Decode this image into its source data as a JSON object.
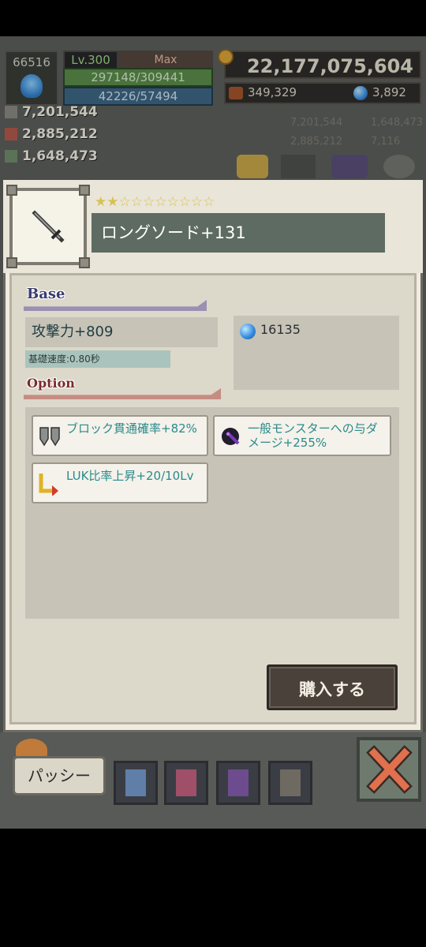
{
  "hud": {
    "player_id": "66516",
    "level": "Lv.300",
    "max_label": "Max",
    "hp": "297148/309441",
    "mp": "42226/57494",
    "gold": "22,177,075,604",
    "resource_a": "349,329",
    "resource_b": "3,892",
    "stat_1": "7,201,544",
    "stat_2": "2,885,212",
    "stat_3": "1,648,473",
    "right_stat_1": "7,201,544",
    "right_stat_2": "1,648,473",
    "right_stat_3": "2,885,212",
    "right_stat_4": "7,116"
  },
  "item": {
    "stars_filled": 2,
    "stars_total": 10,
    "stars_text": "★★☆☆☆☆☆☆☆☆",
    "name": "ロングソード+131",
    "icon": "sword-icon"
  },
  "base": {
    "label": "Base",
    "attack": "攻撃力+809",
    "speed": "基礎速度:0.80秒",
    "price": "16135"
  },
  "option": {
    "label": "Option",
    "items": [
      {
        "text": "ブロック貫通確率+82%",
        "icon": "shield-pierce-icon"
      },
      {
        "text": "一般モンスターへの与ダメージ+255%",
        "icon": "dark-monster-icon"
      },
      {
        "text": "LUK比率上昇+20/10Lv",
        "icon": "luk-arrow-icon"
      }
    ]
  },
  "buttons": {
    "buy": "購入する",
    "passy": "パッシー",
    "close": "close-icon"
  },
  "colors": {
    "panel": "#efebdf",
    "name_bar": "#5e6b63",
    "option_text": "#2a8a8c",
    "buy_button": "#4a423a"
  }
}
